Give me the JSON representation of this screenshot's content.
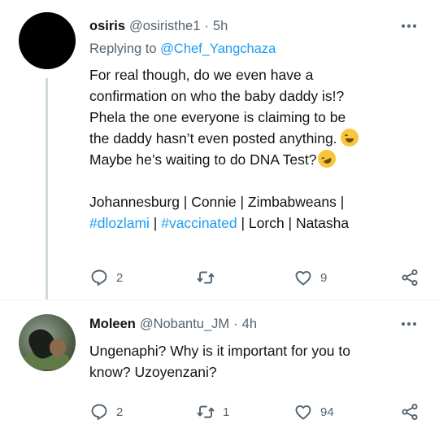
{
  "tweets": [
    {
      "display_name": "osiris",
      "handle": "@osiristhe1",
      "separator": "·",
      "time": "5h",
      "replying_prefix": "Replying to",
      "replying_to": "@Chef_Yangchaza",
      "text_lines": [
        "For real though, do we even have a",
        "confirmation on who the baby daddy is!?",
        "Phela the one everyone is claiming to be",
        "the daddy hasn’t even posted anything.",
        "Maybe he’s waiting to do DNA Test?"
      ],
      "emojis": [
        "😂",
        "🤣"
      ],
      "tags_line_1": "Johannesburg | Connie | Zimbabweans |",
      "hashtag_1": "#dlozlami",
      "sep_1": " | ",
      "hashtag_2": "#vaccinated",
      "tags_tail": " | Lorch | Natasha",
      "reply_count": "2",
      "retweet_count": "",
      "like_count": "9"
    },
    {
      "display_name": "Moleen",
      "handle": "@Nobantu_JM",
      "separator": "·",
      "time": "4h",
      "text_lines": [
        "Ungenaphi? Why is it important for you to",
        "know? Uzoyenzani?"
      ],
      "reply_count": "2",
      "retweet_count": "1",
      "like_count": "94"
    }
  ],
  "icons": {
    "more": "more-horizontal-icon",
    "reply": "reply-bubble-icon",
    "retweet": "retweet-icon",
    "like": "heart-icon",
    "share": "share-icon"
  },
  "colors": {
    "link": "#1d9bf0",
    "secondary_text": "#536471",
    "primary_text": "#0f1419",
    "thread_line": "#cfd9de"
  }
}
